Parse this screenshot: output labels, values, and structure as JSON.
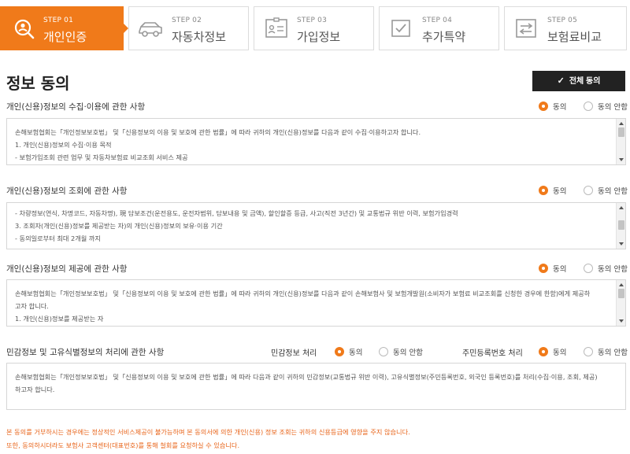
{
  "steps": [
    {
      "num": "STEP 01",
      "title": "개인인증",
      "icon": "person-search-icon",
      "active": true
    },
    {
      "num": "STEP 02",
      "title": "자동차정보",
      "icon": "car-icon",
      "active": false
    },
    {
      "num": "STEP 03",
      "title": "가입정보",
      "icon": "id-card-icon",
      "active": false
    },
    {
      "num": "STEP 04",
      "title": "추가특약",
      "icon": "checkbox-icon",
      "active": false
    },
    {
      "num": "STEP 05",
      "title": "보험료비교",
      "icon": "compare-icon",
      "active": false
    }
  ],
  "page": {
    "title": "정보 동의",
    "agree_all": "전체 동의",
    "agree_all_icon": "checkmark-icon"
  },
  "labels": {
    "agree": "동의",
    "disagree": "동의 안함"
  },
  "sections": {
    "collect": {
      "title": "개인(신용)정보의 수집·이용에 관한 사항",
      "selected": "동의",
      "lines": [
        "손해보험협회는「개인정보보호법」 및「신용정보의 이용 및 보호에 관한 법률」에 따라 귀하의 개인(신용)정보를 다음과 같이 수집·이용하고자 합니다.",
        "1. 개인(신용)정보의 수집·이용 목적",
        "- 보험가입조회 관련 업무 및 자동차보험료 비교조회 서비스 제공"
      ]
    },
    "inquiry": {
      "title": "개인(신용)정보의 조회에 관한 사항",
      "selected": "동의",
      "lines": [
        "- 차량정보(연식, 차명코드, 자동차명), 現 담보조건(운전용도, 운전자범위, 담보내용 및 금액), 할인할증 등급, 사고(직전 3년간) 및 교통법규 위반 이력, 보험가입경력",
        "3. 조회자(개인(신용)정보를 제공받는 자)의 개인(신용)정보의 보유·이용 기간",
        "- 동의일로부터 최대 2개월 까지"
      ]
    },
    "provide": {
      "title": "개인(신용)정보의 제공에 관한 사항",
      "selected": "동의",
      "lines": [
        "손해보험협회는「개인정보보호법」 및「신용정보의 이용 및 보호에 관한 법률」에 따라 귀하의 개인(신용)정보를 다음과 같이 손해보험사 및 보험개발원(소비자가 보험료 비교조회를 신청한 경우에 한함)에게 제공하",
        "고자 합니다.",
        "1. 개인(신용)정보를 제공받는 자"
      ]
    },
    "sensitive": {
      "title": "민감정보 및 고유식별정보의 처리에 관한 사항",
      "sub1_label": "민감정보 처리",
      "sub1_selected": "동의",
      "sub2_label": "주민등록번호 처리",
      "sub2_selected": "동의",
      "lines": [
        "손해보험협회는「개인정보보호법」 및「신용정보의 이용 및 보호에 관한 법률」에 따라 다음과 같이 귀하의 민감정보(교통법규 위반 이력), 고유식별정보(주민등록번호, 외국인 등록번호)를 처리(수집·이용, 조회, 제공)",
        "하고자 합니다."
      ]
    }
  },
  "notice": [
    "본 동의를 거부하시는 경우에는 정상적인 서비스제공이 불가능하며 본 동의서에 의한 개인(신용) 정보 조회는 귀하의 신용등급에 영향을 주지 않습니다.",
    "또한, 동의하시더라도 보험사 고객센터(대표번호)를 통해 철회를 요청하실 수 있습니다."
  ],
  "colors": {
    "accent": "#f07a1a",
    "dark": "#222222",
    "notice": "#e8641a"
  }
}
